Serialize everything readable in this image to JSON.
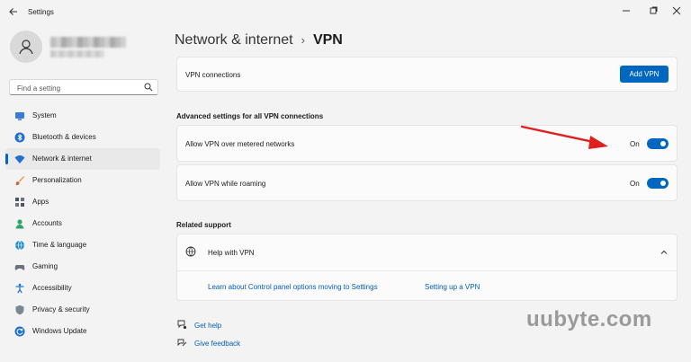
{
  "window": {
    "title": "Settings"
  },
  "sidebar": {
    "search_placeholder": "Find a setting",
    "items": [
      {
        "label": "System",
        "icon": "system-icon"
      },
      {
        "label": "Bluetooth & devices",
        "icon": "bluetooth-icon"
      },
      {
        "label": "Network & internet",
        "icon": "wifi-icon",
        "active": true
      },
      {
        "label": "Personalization",
        "icon": "brush-icon"
      },
      {
        "label": "Apps",
        "icon": "apps-icon"
      },
      {
        "label": "Accounts",
        "icon": "accounts-icon"
      },
      {
        "label": "Time & language",
        "icon": "globe-clock-icon"
      },
      {
        "label": "Gaming",
        "icon": "controller-icon"
      },
      {
        "label": "Accessibility",
        "icon": "accessibility-icon"
      },
      {
        "label": "Privacy & security",
        "icon": "shield-icon"
      },
      {
        "label": "Windows Update",
        "icon": "update-icon"
      }
    ]
  },
  "breadcrumb": {
    "parent": "Network & internet",
    "separator": "›",
    "current": "VPN"
  },
  "vpn_connections": {
    "label": "VPN connections",
    "button": "Add VPN"
  },
  "advanced": {
    "title": "Advanced settings for all VPN connections",
    "metered": {
      "label": "Allow VPN over metered networks",
      "state": "On",
      "on": true
    },
    "roaming": {
      "label": "Allow VPN while roaming",
      "state": "On",
      "on": true
    }
  },
  "related": {
    "title": "Related support",
    "help": {
      "label": "Help with VPN"
    },
    "links": [
      "Learn about Control panel options moving to Settings",
      "Setting up a VPN"
    ]
  },
  "footer": {
    "get_help": "Get help",
    "give_feedback": "Give feedback"
  },
  "watermark": "uubyte.com",
  "colors": {
    "accent": "#0067c0",
    "link": "#005fb8",
    "annotation_arrow": "#e0201e"
  }
}
